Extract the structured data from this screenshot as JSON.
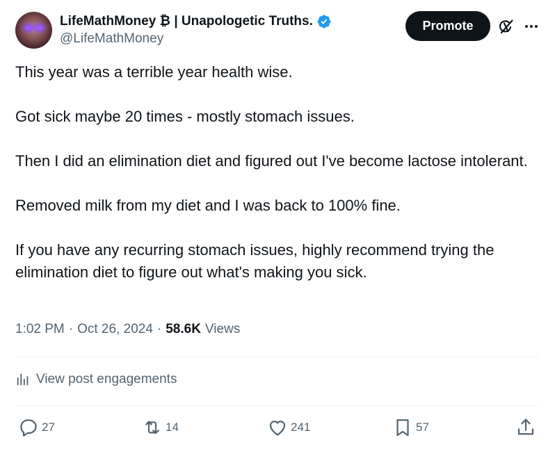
{
  "author": {
    "display_name": "LifeMathMoney ₿ | Unapologetic Truths.",
    "handle": "@LifeMathMoney"
  },
  "header": {
    "promote_label": "Promote"
  },
  "tweet": {
    "paragraphs": [
      "This year was a terrible year health wise.",
      "Got sick maybe 20 times - mostly stomach issues.",
      "Then I did an elimination diet and figured out I've become lactose intolerant.",
      "Removed milk from my diet and I was back to 100% fine.",
      "If you have any recurring stomach issues, highly recommend trying the elimination diet to figure out what's making you sick."
    ],
    "time": "1:02 PM",
    "date": "Oct 26, 2024",
    "views_count": "58.6K",
    "views_label": "Views"
  },
  "engagements_label": "View post engagements",
  "actions": {
    "replies": "27",
    "reposts": "14",
    "likes": "241",
    "bookmarks": "57"
  },
  "icons": {
    "verified": "verified-badge-icon",
    "grok": "grok-icon",
    "more": "more-icon",
    "analytics": "analytics-icon",
    "reply": "reply-icon",
    "repost": "repost-icon",
    "like": "heart-icon",
    "bookmark": "bookmark-icon",
    "share": "share-icon"
  },
  "colors": {
    "verified_blue": "#1d9bf0",
    "primary_text": "#0f1419",
    "secondary_text": "#536471",
    "promote_bg": "#0f1419"
  }
}
